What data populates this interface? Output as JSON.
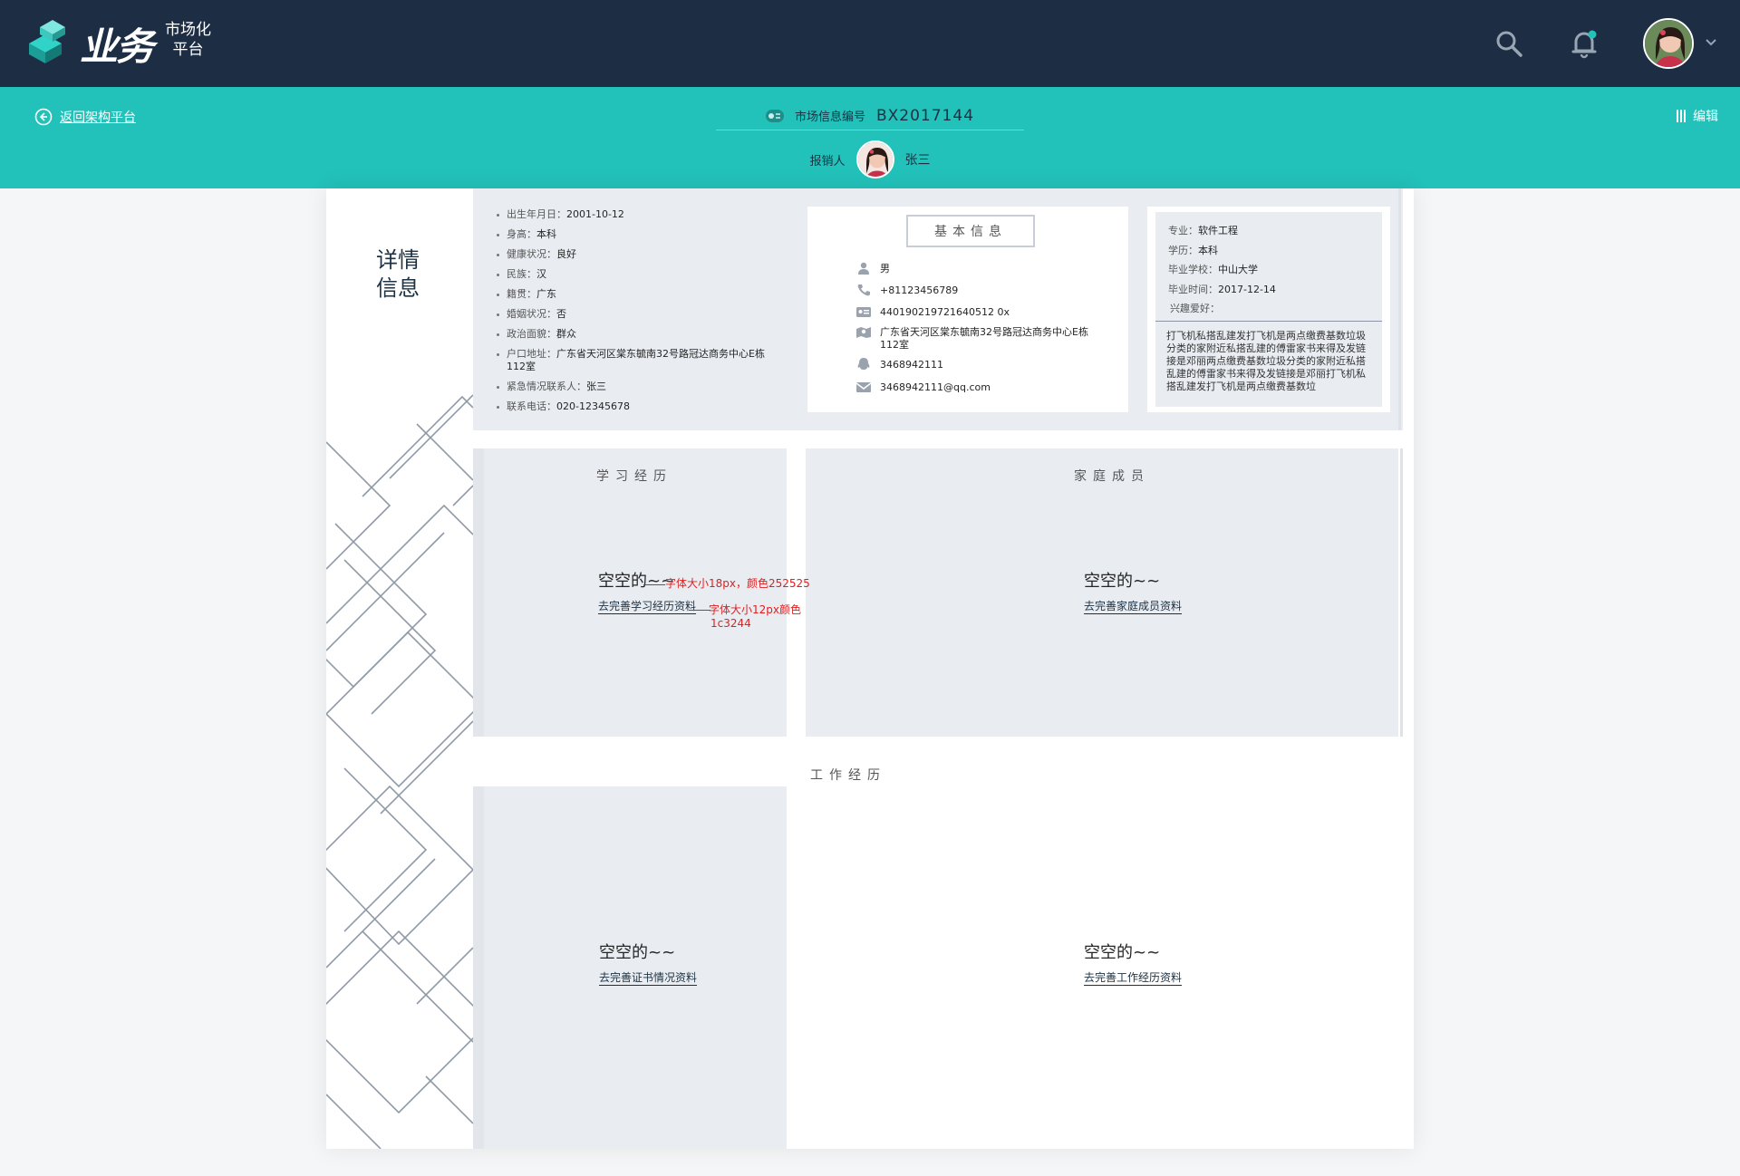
{
  "app": {
    "brand_big": "业务",
    "brand_small_1": "市场化",
    "brand_small_2": "平台"
  },
  "header": {
    "icons": [
      "search-icon",
      "bell-icon",
      "chevron-down-icon"
    ],
    "accent": "#22c1b9",
    "navy": "#1c2d44"
  },
  "subbar": {
    "back_label": "返回架构平台",
    "code_label": "市场信息编号",
    "code_value": "BX2017144",
    "reporter_label": "报销人",
    "reporter_name": "张三",
    "edit_label": "编辑"
  },
  "side": {
    "title_1": "详情",
    "title_2": "信息"
  },
  "personal": [
    {
      "label": "出生年月日：",
      "value": "2001-10-12"
    },
    {
      "label": "身高：",
      "value": "本科"
    },
    {
      "label": "健康状况：",
      "value": "良好"
    },
    {
      "label": "民族：",
      "value": "汉"
    },
    {
      "label": "籍贯：",
      "value": "广东"
    },
    {
      "label": "婚姻状况：",
      "value": "否"
    },
    {
      "label": "政治面貌：",
      "value": "群众"
    },
    {
      "label": "户口地址：",
      "value": "广东省天河区棠东毓南32号路冠达商务中心E栋112室"
    },
    {
      "label": "紧急情况联系人：",
      "value": "张三"
    },
    {
      "label": "联系电话：",
      "value": "020-12345678"
    }
  ],
  "basic": {
    "title": "基本信息",
    "gender": "男",
    "phone": "+81123456789",
    "id_card": "440190219721640512 0x",
    "address": "广东省天河区棠东毓南32号路冠达商务中心E栋112室",
    "qq": "3468942111",
    "email": "3468942111@qq.com"
  },
  "education": {
    "major_label": "专业：",
    "major": "软件工程",
    "degree_label": "学历：",
    "degree": "本科",
    "school_label": "毕业学校：",
    "school": "中山大学",
    "grad_label": "毕业时间：",
    "grad_date": "2017-12-14",
    "hobby_label": "兴趣爱好：",
    "hobby_text": "打飞机私搭乱建发打飞机是两点缴费基数垃圾分类的家附近私搭乱建的傅雷家书来得及发链接是邓丽两点缴费基数垃圾分类的家附近私搭乱建的傅雷家书来得及发链接是邓丽打飞机私搭乱建发打飞机是两点缴费基数垃"
  },
  "sections": {
    "study": "学习经历",
    "family": "家庭成员",
    "work": "工作经历"
  },
  "empties": {
    "big_text": "空空的~~",
    "study_link": "去完善学习经历资料",
    "family_link": "去完善家庭成员资料",
    "cert_link": "去完善证书情况资料",
    "work_link": "去完善工作经历资料"
  },
  "annotations": {
    "a1": "字体大小18px，颜色252525",
    "a2_1": "字体大小12px颜色",
    "a2_2": "1c3244"
  }
}
